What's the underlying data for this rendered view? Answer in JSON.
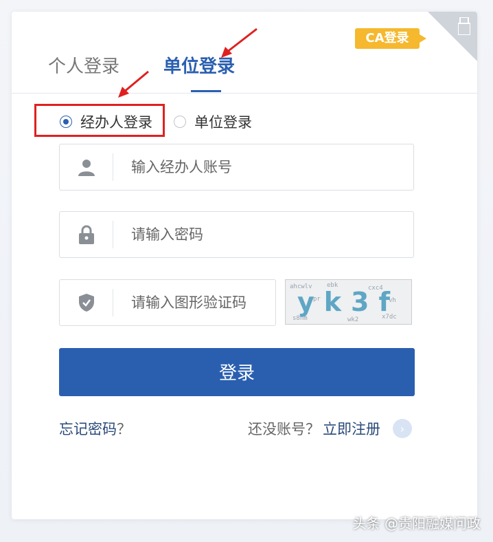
{
  "ca_badge": "CA登录",
  "tabs": {
    "personal": "个人登录",
    "unit": "单位登录"
  },
  "login_type": {
    "agent": "经办人登录",
    "unit": "单位登录",
    "selected": "agent"
  },
  "fields": {
    "account_placeholder": "输入经办人账号",
    "password_placeholder": "请输入密码",
    "captcha_placeholder": "请输入图形验证码"
  },
  "captcha_text": "yk3f",
  "login_button": "登录",
  "forgot_password": "忘记密码",
  "forgot_suffix": "？",
  "no_account": "还没账号？",
  "register": "立即注册",
  "watermark": "头条 @贵阳融媒问政",
  "colors": {
    "primary": "#2a5fb0",
    "badge": "#f5b82e",
    "highlight_red": "#e02020"
  },
  "icons": [
    "user-icon",
    "lock-icon",
    "shield-icon",
    "usb-key-icon",
    "chevron-right-icon"
  ]
}
